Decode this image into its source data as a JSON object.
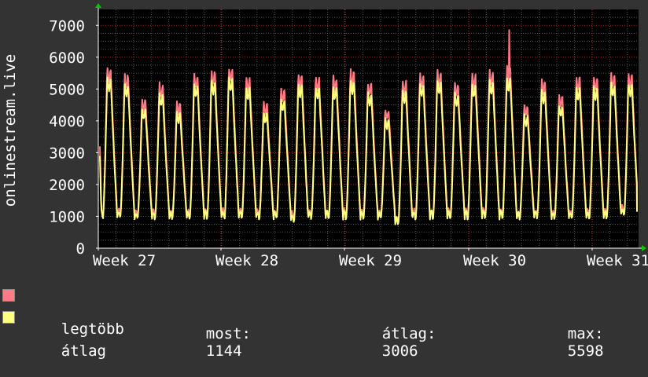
{
  "chart_data": {
    "type": "line",
    "ylabel": "onlinestream.live",
    "ylim": [
      0,
      7500
    ],
    "yticks": [
      0,
      1000,
      2000,
      3000,
      4000,
      5000,
      6000,
      7000
    ],
    "xticks": [
      "Week 27",
      "Week 28",
      "Week 29",
      "Week 30",
      "Week 31"
    ],
    "grid": true,
    "legend_placement": "bottom-left",
    "series": [
      {
        "name": "legtöbb",
        "color": "#ff7a85"
      },
      {
        "name": "átlag",
        "color": "#ffff80"
      }
    ],
    "daily_peaks": [
      5700,
      5500,
      4700,
      5200,
      4600,
      5500,
      5600,
      5700,
      5400,
      4600,
      5000,
      5500,
      5400,
      5400,
      5600,
      5200,
      4400,
      5300,
      5500,
      5600,
      5200,
      5500,
      5600,
      5700,
      4500,
      5300,
      4800,
      5400,
      5400,
      5500,
      5500
    ],
    "daily_troughs": [
      1000,
      1000,
      1000,
      1000,
      1000,
      1000,
      1000,
      1000,
      1000,
      1000,
      1000,
      900,
      1000,
      1000,
      1000,
      1000,
      1000,
      800,
      1000,
      1000,
      1000,
      1000,
      1000,
      1000,
      1000,
      1000,
      1000,
      1000,
      1000,
      1000,
      1100
    ],
    "spike": {
      "week": "Week 30",
      "value": 6850
    },
    "start_value": 3200,
    "end_value": 1144
  },
  "legend": {
    "max_label": "legtöbb",
    "avg_label": "átlag",
    "now_label": "most:",
    "now_value": "1144",
    "avg_stat_label": "átlag:",
    "avg_stat_value": "3006",
    "max_stat_label": "max:",
    "max_stat_value": "5598"
  },
  "colors": {
    "background": "#333333",
    "plot_bg": "#000000",
    "max_line": "#ff7a85",
    "avg_line": "#ffff80",
    "axis_arrow": "#00cc00",
    "major_grid": "#ff3030",
    "minor_grid": "#555555"
  }
}
